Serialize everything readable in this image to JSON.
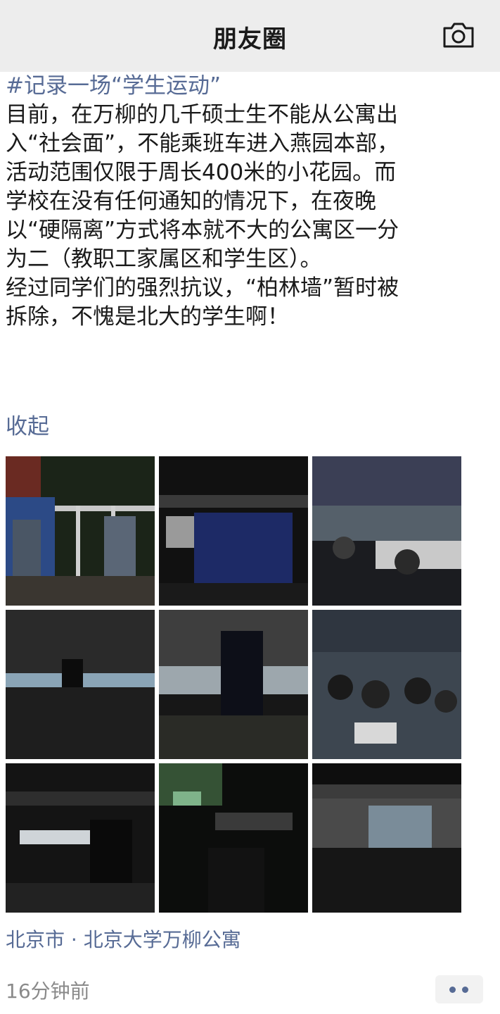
{
  "header": {
    "title": "朋友圈",
    "camera_icon": "camera-icon"
  },
  "post": {
    "hashtag": "#记录一场“学生运动”",
    "lines": [
      "目前，在万柳的几千硕士生不能从公寓出",
      "入“社会面”，不能乘班车进入燕园本部，",
      "活动范围仅限于周长400米的小花园。而",
      "学校在没有任何通知的情况下，在夜晚",
      "以“硬隔离”方式将本就不大的公寓区一分",
      "为二（教职工家属区和学生区）。",
      "经过同学们的强烈抗议，“柏林墙”暂时被",
      "拆除，不愧是北大的学生啊！"
    ],
    "collapse_label": "收起",
    "location": "北京市 · 北京大学万柳公寓",
    "time": "16分钟前",
    "more_icon": "more-dots-icon"
  },
  "colors": {
    "link": "#576b95",
    "header_bg": "#ededed",
    "text": "#1a1a1a",
    "meta": "#8a8a8a"
  }
}
